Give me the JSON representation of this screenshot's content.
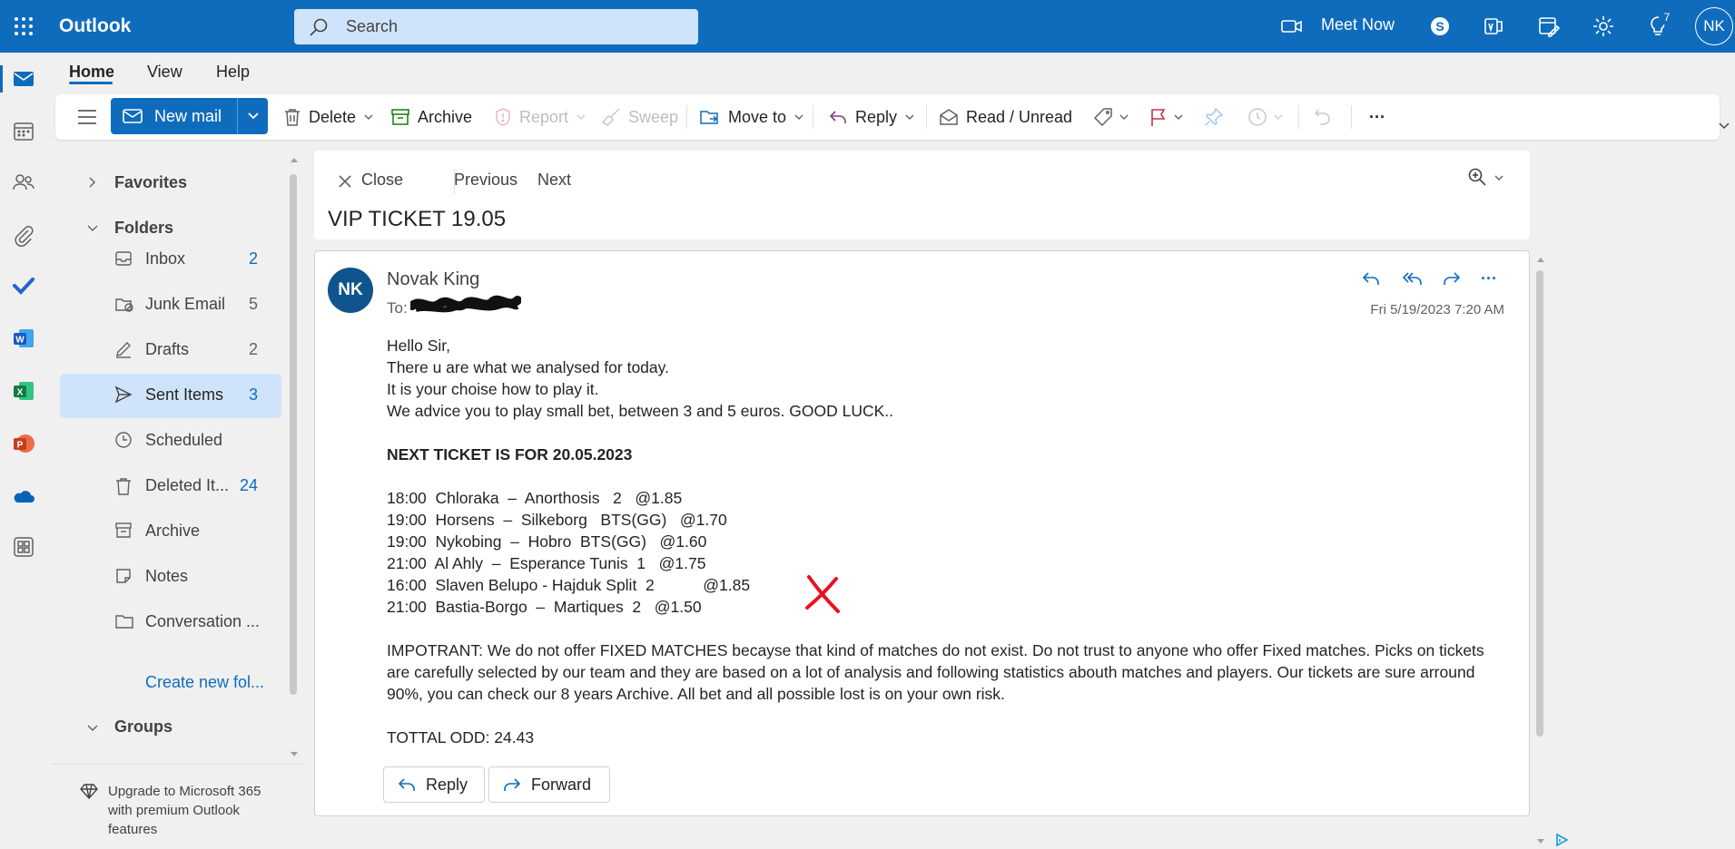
{
  "app": {
    "title": "Outlook"
  },
  "search": {
    "placeholder": "Search"
  },
  "topbar": {
    "meet_now": "Meet Now",
    "tips_badge": "7",
    "avatar_initials": "NK"
  },
  "tabs": [
    "Home",
    "View",
    "Help"
  ],
  "ribbon": {
    "new_mail": "New mail",
    "delete": "Delete",
    "archive": "Archive",
    "report": "Report",
    "sweep": "Sweep",
    "move_to": "Move to",
    "reply": "Reply",
    "read_unread": "Read / Unread",
    "more": "···"
  },
  "folders": {
    "favorites": "Favorites",
    "folders_header": "Folders",
    "items": [
      {
        "label": "Inbox",
        "count": "2",
        "icon": "inbox-icon"
      },
      {
        "label": "Junk Email",
        "count": "5",
        "icon": "junk-icon"
      },
      {
        "label": "Drafts",
        "count": "2",
        "icon": "drafts-icon"
      },
      {
        "label": "Sent Items",
        "count": "3",
        "icon": "send-icon"
      },
      {
        "label": "Scheduled",
        "count": "",
        "icon": "clock-icon"
      },
      {
        "label": "Deleted It...",
        "count": "24",
        "icon": "trash-icon"
      },
      {
        "label": "Archive",
        "count": "",
        "icon": "archive-icon"
      },
      {
        "label": "Notes",
        "count": "",
        "icon": "note-icon"
      },
      {
        "label": "Conversation ...",
        "count": "",
        "icon": "folder-icon"
      }
    ],
    "create_new": "Create new fol...",
    "groups": "Groups",
    "upgrade": "Upgrade to Microsoft 365 with premium Outlook features"
  },
  "reading": {
    "close": "Close",
    "previous": "Previous",
    "next": "Next",
    "subject": "VIP TICKET 19.05"
  },
  "message": {
    "avatar": "NK",
    "sender": "Novak King",
    "to_label": "To:",
    "date": "Fri 5/19/2023 7:20 AM",
    "greeting": "Hello Sir,",
    "line1": "There u are what we analysed for today.",
    "line2": "It is your choise how to play it.",
    "line3": "We advice you to play small bet, between 3 and 5 euros. GOOD LUCK..",
    "next_ticket": "NEXT TICKET IS FOR 20.05.2023",
    "picks": [
      "18:00  Chloraka  –  Anorthosis   2   @1.85",
      "19:00  Horsens  –  Silkeborg   BTS(GG)   @1.70",
      "19:00  Nykobing  –  Hobro  BTS(GG)   @1.60",
      "21:00  Al Ahly  –  Esperance Tunis  1   @1.75",
      "16:00  Slaven Belupo - Hajduk Split  2           @1.85",
      "21:00  Bastia-Borgo  –  Martiques  2   @1.50"
    ],
    "important": "IMPOTRANT: We do not offer FIXED MATCHES becayse that kind of matches do not exist. Do not trust to anyone who offer Fixed matches. Picks on tickets are carefully selected by our team and they are based on a lot of analysis and following statistics abouth matches and players. Our tickets are sure arround 90%, you can check our 8 years Archive. All bet and all possible lost is on your own risk.",
    "total": "TOTTAL ODD: 24.43",
    "reply_btn": "Reply",
    "forward_btn": "Forward"
  },
  "colors": {
    "brand": "#0f6cbd",
    "selected": "#cfe4fa",
    "flag": "#c4314b",
    "x_mark": "#e81123"
  }
}
